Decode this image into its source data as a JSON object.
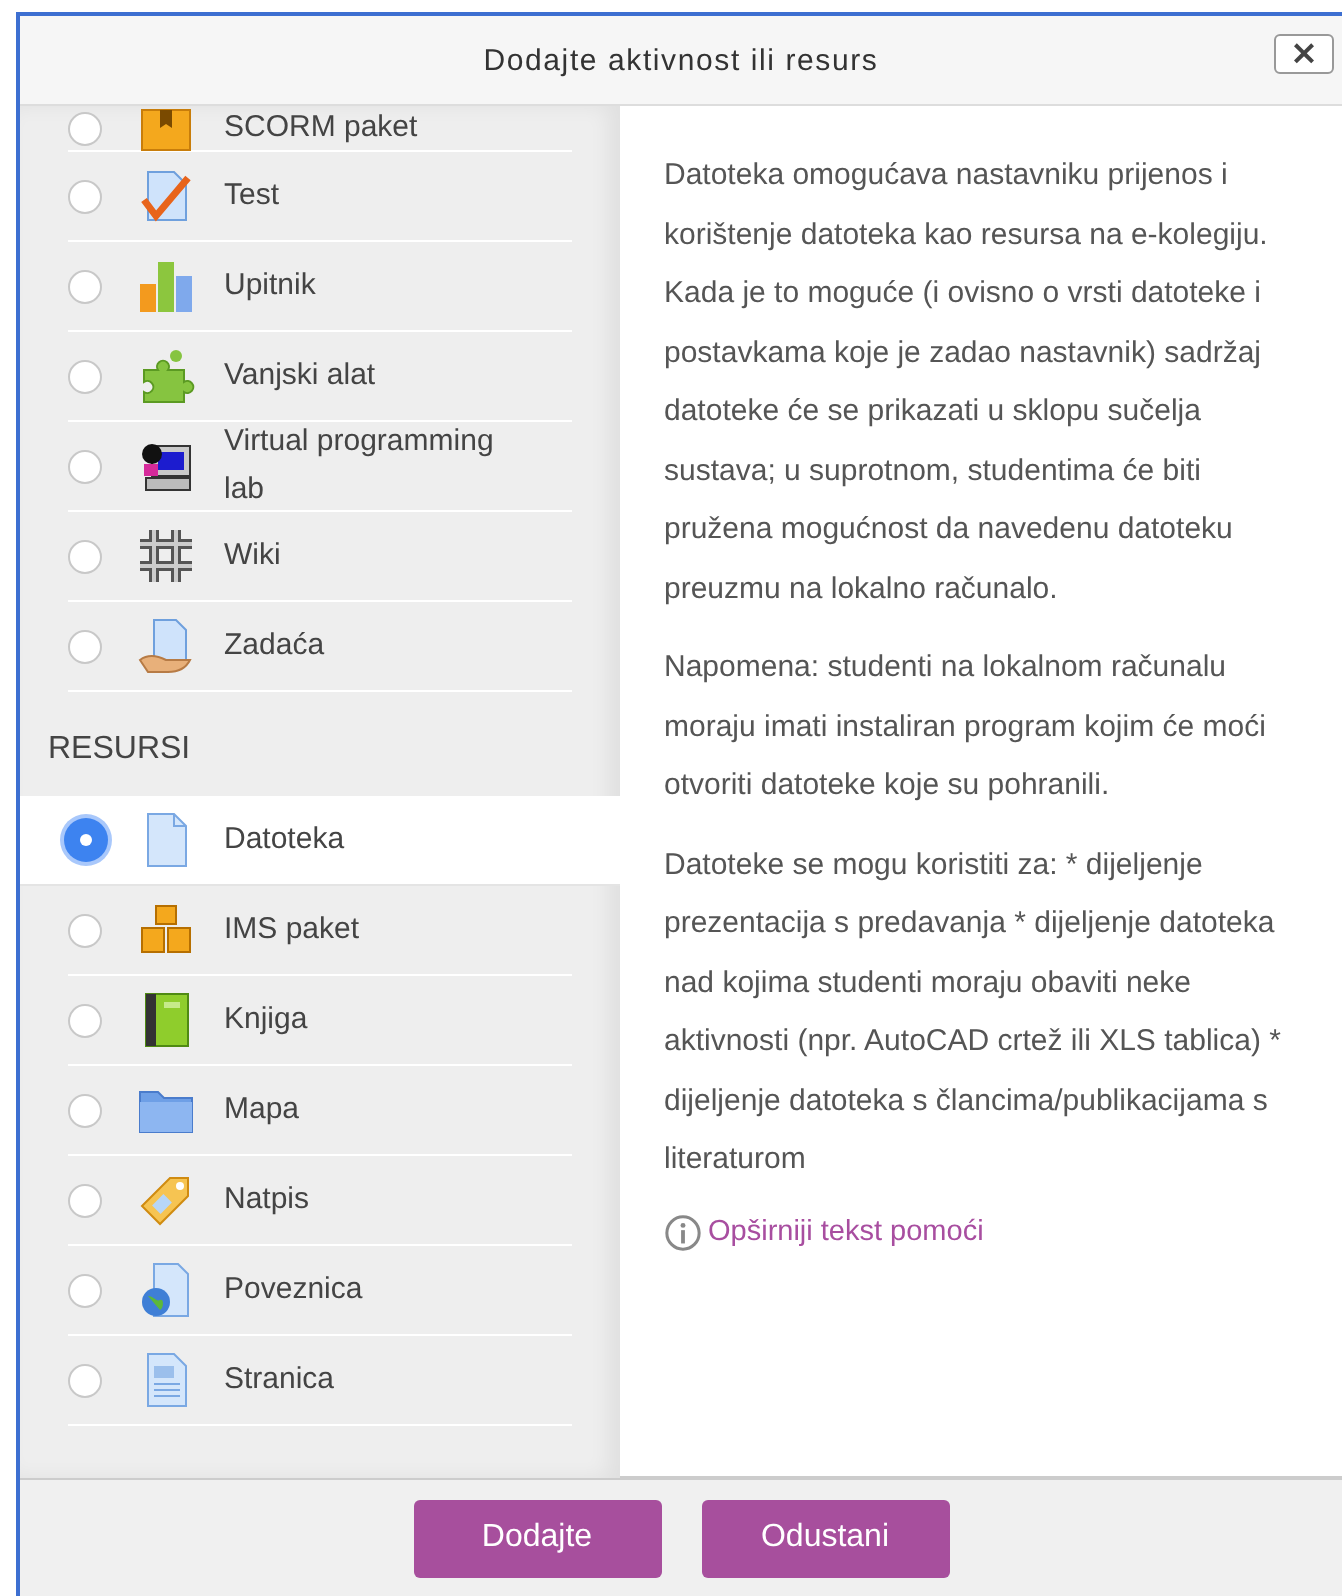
{
  "dialog": {
    "title": "Dodajte aktivnost ili resurs",
    "close": "×"
  },
  "groups": [
    {
      "items": [
        {
          "label": "SCORM paket",
          "selected": false
        },
        {
          "label": "Test",
          "selected": false
        },
        {
          "label": "Upitnik",
          "selected": false
        },
        {
          "label": "Vanjski alat",
          "selected": false
        },
        {
          "label": "Virtual programming lab",
          "selected": false
        },
        {
          "label": "Wiki",
          "selected": false
        },
        {
          "label": "Zadaća",
          "selected": false
        }
      ]
    },
    {
      "heading": "RESURSI",
      "items": [
        {
          "label": "Datoteka",
          "selected": true
        },
        {
          "label": "IMS paket",
          "selected": false
        },
        {
          "label": "Knjiga",
          "selected": false
        },
        {
          "label": "Mapa",
          "selected": false
        },
        {
          "label": "Natpis",
          "selected": false
        },
        {
          "label": "Poveznica",
          "selected": false
        },
        {
          "label": "Stranica",
          "selected": false
        }
      ]
    }
  ],
  "description": [
    "Datoteka omogućava nastavniku prijenos i korištenje datoteka kao resursa na e-kolegiju. Kada je to moguće (i ovisno o vrsti datoteke i postavkama koje je zadao nastavnik) sadržaj datoteke će se prikazati u sklopu sučelja sustava; u suprotnom, studentima će biti pružena mogućnost da navedenu datoteku preuzmu na lokalno računalo.",
    "Napomena: studenti na lokalnom računalu moraju imati instaliran program kojim će moći otvoriti datoteke koje su pohranili.",
    "Datoteke se mogu koristiti za: * dijeljenje prezentacija s predavanja * dijeljenje datoteka nad kojima studenti moraju obaviti neke aktivnosti (npr. AutoCAD crtež ili XLS tablica) * dijeljenje datoteka s člancima/publikacijama s literaturom"
  ],
  "help_link": "Opširniji tekst pomoći",
  "buttons": [
    "Dodajte",
    "Odustani"
  ]
}
